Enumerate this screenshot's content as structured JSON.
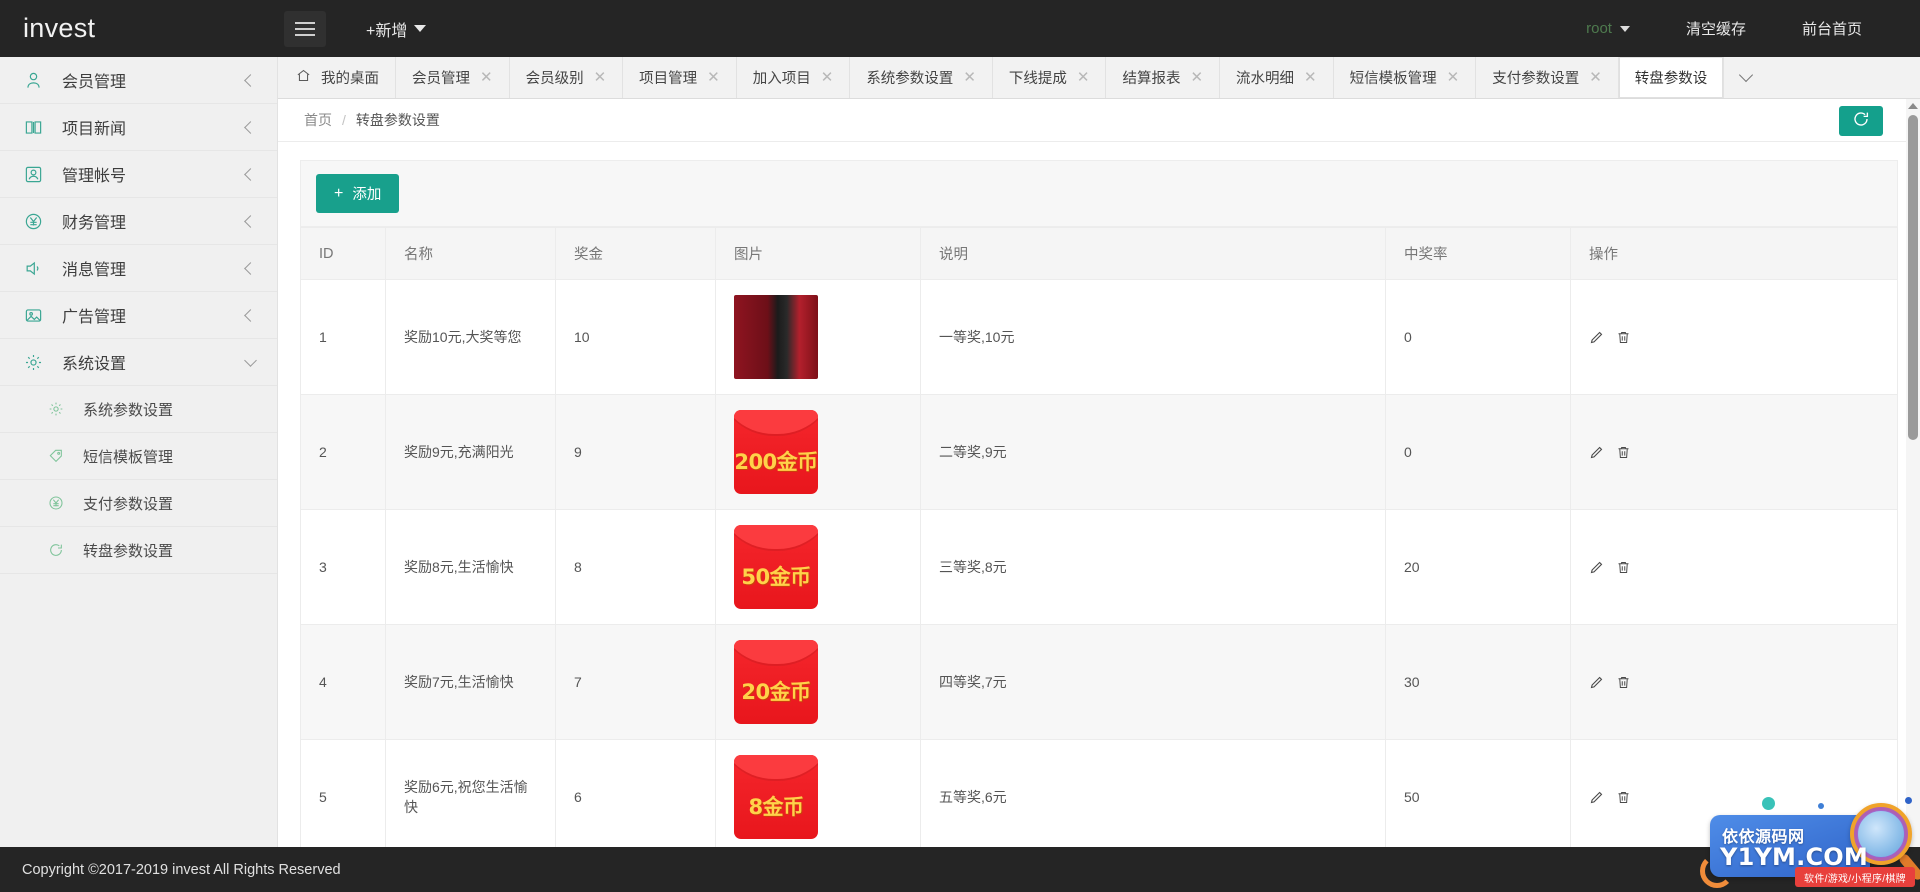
{
  "header": {
    "brand": "invest",
    "menu_toggle_icon": "hamburger-icon",
    "add_new_label": "+新增",
    "user": "root",
    "clear_cache_label": "清空缓存",
    "frontend_home_label": "前台首页"
  },
  "sidebar": {
    "items": [
      {
        "label": "会员管理",
        "icon": "user-icon",
        "state": "collapsed"
      },
      {
        "label": "项目新闻",
        "icon": "book-icon",
        "state": "collapsed"
      },
      {
        "label": "管理帐号",
        "icon": "account-icon",
        "state": "collapsed"
      },
      {
        "label": "财务管理",
        "icon": "yen-circle-icon",
        "state": "collapsed"
      },
      {
        "label": "消息管理",
        "icon": "speaker-icon",
        "state": "collapsed"
      },
      {
        "label": "广告管理",
        "icon": "image-icon",
        "state": "collapsed"
      },
      {
        "label": "系统设置",
        "icon": "gear-icon",
        "state": "expanded"
      }
    ],
    "submenu": [
      {
        "label": "系统参数设置",
        "icon": "gear-icon"
      },
      {
        "label": "短信模板管理",
        "icon": "tag-icon"
      },
      {
        "label": "支付参数设置",
        "icon": "yen-circle-icon"
      },
      {
        "label": "转盘参数设置",
        "icon": "refresh-circle-icon"
      }
    ]
  },
  "tabs": {
    "home_label": "我的桌面",
    "items": [
      {
        "label": "会员管理",
        "closable": true,
        "active": false
      },
      {
        "label": "会员级别",
        "closable": true,
        "active": false
      },
      {
        "label": "项目管理",
        "closable": true,
        "active": false
      },
      {
        "label": "加入项目",
        "closable": true,
        "active": false
      },
      {
        "label": "系统参数设置",
        "closable": true,
        "active": false
      },
      {
        "label": "下线提成",
        "closable": true,
        "active": false
      },
      {
        "label": "结算报表",
        "closable": true,
        "active": false
      },
      {
        "label": "流水明细",
        "closable": true,
        "active": false
      },
      {
        "label": "短信模板管理",
        "closable": true,
        "active": false
      },
      {
        "label": "支付参数设置",
        "closable": true,
        "active": false
      },
      {
        "label": "转盘参数设",
        "closable": false,
        "active": true
      }
    ],
    "close_glyph": "✕",
    "dropdown_icon": "chevron-down-icon"
  },
  "breadcrumb": {
    "home": "首页",
    "separator": "/",
    "current": "转盘参数设置",
    "refresh_icon": "refresh-icon"
  },
  "toolbar": {
    "add_label": "添加",
    "add_plus": "+"
  },
  "table": {
    "headers": [
      "ID",
      "名称",
      "奖金",
      "图片",
      "说明",
      "中奖率",
      "操作"
    ],
    "rows": [
      {
        "id": "1",
        "name": "奖励10元,大奖等您",
        "bonus": "10",
        "image_type": "phone",
        "image_text": "",
        "desc": "一等奖,10元",
        "rate": "0"
      },
      {
        "id": "2",
        "name": "奖励9元,充满阳光",
        "bonus": "9",
        "image_type": "envelope",
        "image_text": "200金币",
        "desc": "二等奖,9元",
        "rate": "0"
      },
      {
        "id": "3",
        "name": "奖励8元,生活愉快",
        "bonus": "8",
        "image_type": "envelope",
        "image_text": "50金币",
        "desc": "三等奖,8元",
        "rate": "20"
      },
      {
        "id": "4",
        "name": "奖励7元,生活愉快",
        "bonus": "7",
        "image_type": "envelope",
        "image_text": "20金币",
        "desc": "四等奖,7元",
        "rate": "30"
      },
      {
        "id": "5",
        "name": "奖励6元,祝您生活愉快",
        "bonus": "6",
        "image_type": "envelope",
        "image_text": "8金币",
        "desc": "五等奖,6元",
        "rate": "50"
      }
    ],
    "edit_icon": "pencil-icon",
    "delete_icon": "trash-icon"
  },
  "footer": {
    "copyright": "Copyright ©2017-2019 invest All Rights Reserved"
  },
  "watermark": {
    "cn": "依依源码网",
    "en": "Y1YM.COM",
    "tagline": "软件/游戏/小程序/棋牌"
  },
  "colors": {
    "accent": "#18a08c",
    "header_bg": "#252525",
    "sidebar_bg": "#f0f0f0",
    "sidebar_icon": "#3aa693"
  }
}
